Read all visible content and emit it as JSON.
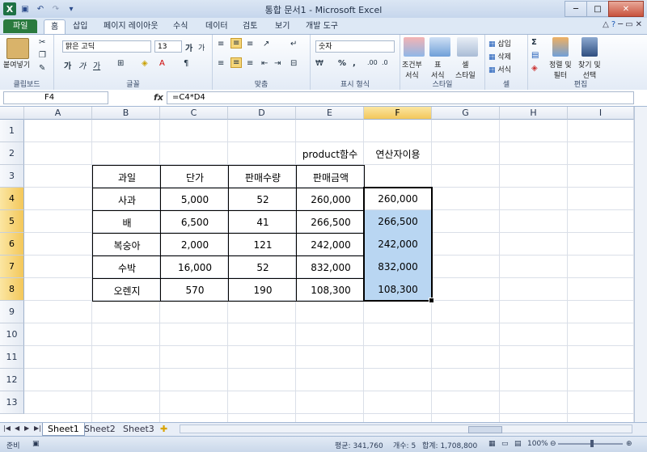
{
  "window": {
    "title": "통합 문서1 - Microsoft Excel",
    "minimize_glyph": "─",
    "maximize_glyph": "□",
    "close_glyph": "✕"
  },
  "quick_access": {
    "save_icon": "save-icon",
    "undo_icon": "undo-icon",
    "redo_icon": "redo-icon"
  },
  "tabs": [
    "파일",
    "홈",
    "삽입",
    "페이지 레이아웃",
    "수식",
    "데이터",
    "검토",
    "보기",
    "개발 도구"
  ],
  "ribbon": {
    "clipboard": {
      "label": "클립보드",
      "paste": "붙여넣기"
    },
    "font": {
      "label": "글꼴",
      "font_name": "맑은 고딕",
      "font_size": "13",
      "bold": "가",
      "italic": "가",
      "underline": "가",
      "grow": "가",
      "shrink": "가"
    },
    "alignment": {
      "label": "맞춤"
    },
    "number": {
      "label": "표시 형식",
      "format": "숫자",
      "percent": "%",
      "comma": ","
    },
    "styles": {
      "label": "스타일",
      "conditional": "조건부\n서식",
      "table": "표\n서식",
      "cell_style": "셀\n스타일"
    },
    "cells": {
      "label": "셀",
      "insert": "삽입",
      "delete": "삭제",
      "format": "서식"
    },
    "editing": {
      "label": "편집",
      "sort": "정렬 및\n필터",
      "find": "찾기 및\n선택"
    }
  },
  "formula_bar": {
    "name_box": "F4",
    "fx": "fx",
    "formula": "=C4*D4"
  },
  "columns": [
    "A",
    "B",
    "C",
    "D",
    "E",
    "F",
    "G",
    "H",
    "I"
  ],
  "selected_column": "F",
  "rows": [
    "1",
    "2",
    "3",
    "4",
    "5",
    "6",
    "7",
    "8",
    "9",
    "10",
    "11",
    "12",
    "13"
  ],
  "selected_rows": [
    "4",
    "5",
    "6",
    "7",
    "8"
  ],
  "cells": {
    "E2": "product함수",
    "F2": "연산자이용",
    "header": [
      "과일",
      "단가",
      "판매수량",
      "판매금액"
    ],
    "data": [
      {
        "fruit": "사과",
        "price": "5,000",
        "qty": "52",
        "amount": "260,000",
        "calc": "260,000"
      },
      {
        "fruit": "배",
        "price": "6,500",
        "qty": "41",
        "amount": "266,500",
        "calc": "266,500"
      },
      {
        "fruit": "복숭아",
        "price": "2,000",
        "qty": "121",
        "amount": "242,000",
        "calc": "242,000"
      },
      {
        "fruit": "수박",
        "price": "16,000",
        "qty": "52",
        "amount": "832,000",
        "calc": "832,000"
      },
      {
        "fruit": "오렌지",
        "price": "570",
        "qty": "190",
        "amount": "108,300",
        "calc": "108,300"
      }
    ]
  },
  "sheets": [
    "Sheet1",
    "Sheet2",
    "Sheet3"
  ],
  "active_sheet": "Sheet1",
  "status": {
    "mode": "준비",
    "average": "평균: 341,760",
    "count": "개수: 5",
    "sum": "합계: 1,708,800",
    "zoom": "100%"
  }
}
